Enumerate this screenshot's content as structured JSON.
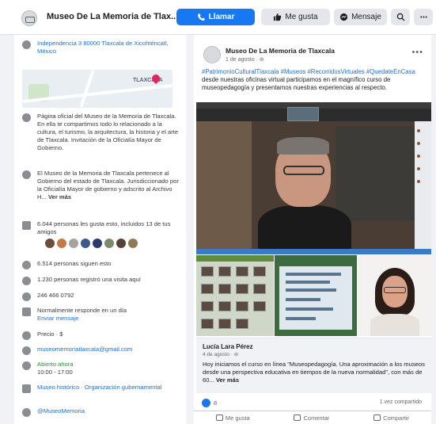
{
  "header": {
    "page_name": "Museo De La Memoria de Tlax...",
    "call_label": "Llamar",
    "like_label": "Me gusta",
    "message_label": "Mensaje"
  },
  "sidebar": {
    "address": "Independencia 3 80000 Tlaxcala de Xicohténcatl, México",
    "map_label": "TLAXCALA",
    "description": "Página oficial del Museo de la Memoria de Tlaxcala. En ella te compartimos todo lo relacionado a la cultura, el turismo, la arquitectura, la historia y el arte de Tlaxcala. Invitación de la Oficialía Mayor de Gobierno.",
    "about": "El Museo de la Memoria de Tlaxcala pertenece al Gobierno del estado de Tlaxcala. Jurisdiccionado por la Oficialía Mayor de gobierno y adscrito al Archivo H...",
    "see_more": "Ver más",
    "likes": "6.044 personas les gusta esto, incluidos 13 de tus amigos",
    "follows": "6.514 personas siguen esto",
    "checkins": "1.230 personas registró una visita aquí",
    "phone": "246 466 0792",
    "response": "Normalmente responde en un día",
    "send_message": "Enviar mensaje",
    "price": "Precio · $",
    "email": "museomemoriatlaxcala@gmail.com",
    "hours_status": "Abierto ahora",
    "hours": "10:00 - 17:00",
    "category": "Museo histórico · Organización gubernamental",
    "twitter": "@MuseoMemoria"
  },
  "post": {
    "author": "Museo De La Memoria de Tlaxcala",
    "time": "1 de agosto · ⊚",
    "hashtags": "#PatrimonioCulturalTlaxcala #Museos #RecorridosVirtuales #QuedateEnCasa",
    "text": "desde nuestras oficinas virtual participamos en el magnífico curso de museopedagogía y presentamos nuestras experiencias al respecto.",
    "shared_author": "Lucía Lara Pérez",
    "shared_time": "4 de agosto · ⊚",
    "shared_text": "Hoy iniciamos el curso en línea \"Museopedagogía. Una aproximación a los museos desde una perspectiva educativa en tiempos de la nueva normalidad\", con más de 60...",
    "shared_more": "Ver más",
    "reaction_count": "8",
    "shares_count": "1 vez compartido",
    "like_action": "Me gusta",
    "comment_action": "Comentar",
    "share_action": "Compartir"
  },
  "colors": {
    "accent": "#1877f2",
    "link": "#216fdb",
    "open_status": "#2e8b3e"
  }
}
